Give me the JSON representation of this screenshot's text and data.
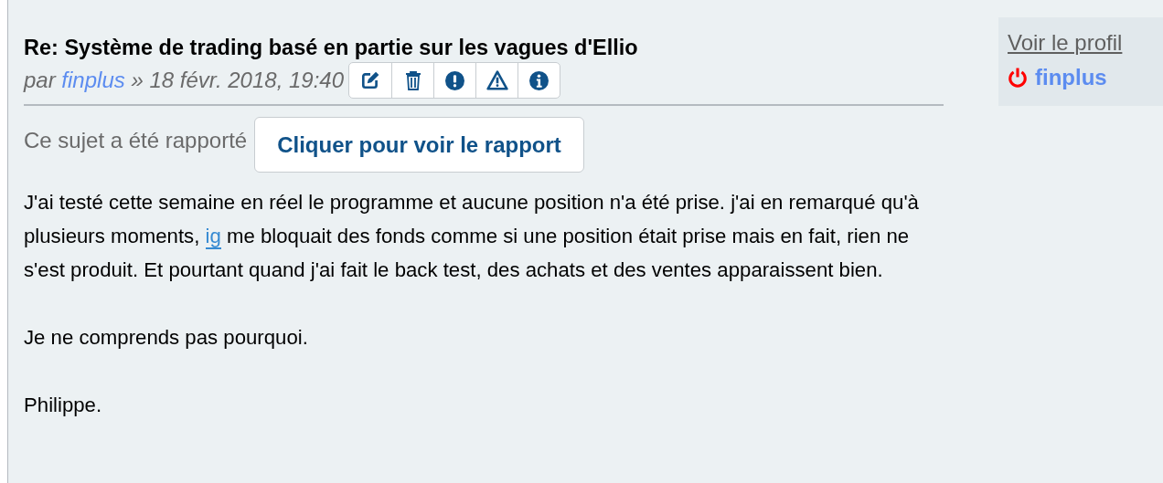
{
  "post": {
    "title": "Re: Système de trading basé en partie sur les vagues d'Ellio",
    "byline": {
      "prefix": "par",
      "author": "finplus",
      "date": "» 18 févr. 2018, 19:40"
    },
    "actions": [
      {
        "kind": "edit"
      },
      {
        "kind": "delete"
      },
      {
        "kind": "warn"
      },
      {
        "kind": "report"
      },
      {
        "kind": "info"
      }
    ],
    "reported": {
      "label": "Ce sujet a été rapporté",
      "button": "Cliquer pour voir le rapport"
    },
    "paragraphs": [
      {
        "before": "J'ai testé cette semaine en réel le programme et aucune position n'a été prise. j'ai en remarqué qu'à plusieurs moments, ",
        "link": "ig",
        "after": " me bloquait des fonds comme si une position était prise mais en fait, rien ne s'est produit. Et pourtant quand j'ai fait le back test, des achats et des ventes apparaissent bien."
      },
      {
        "before": "Je ne comprends pas pourquoi."
      },
      {
        "before": "Philippe."
      }
    ]
  },
  "profile": {
    "link": "Voir le profil",
    "username": "finplus",
    "online": true
  }
}
